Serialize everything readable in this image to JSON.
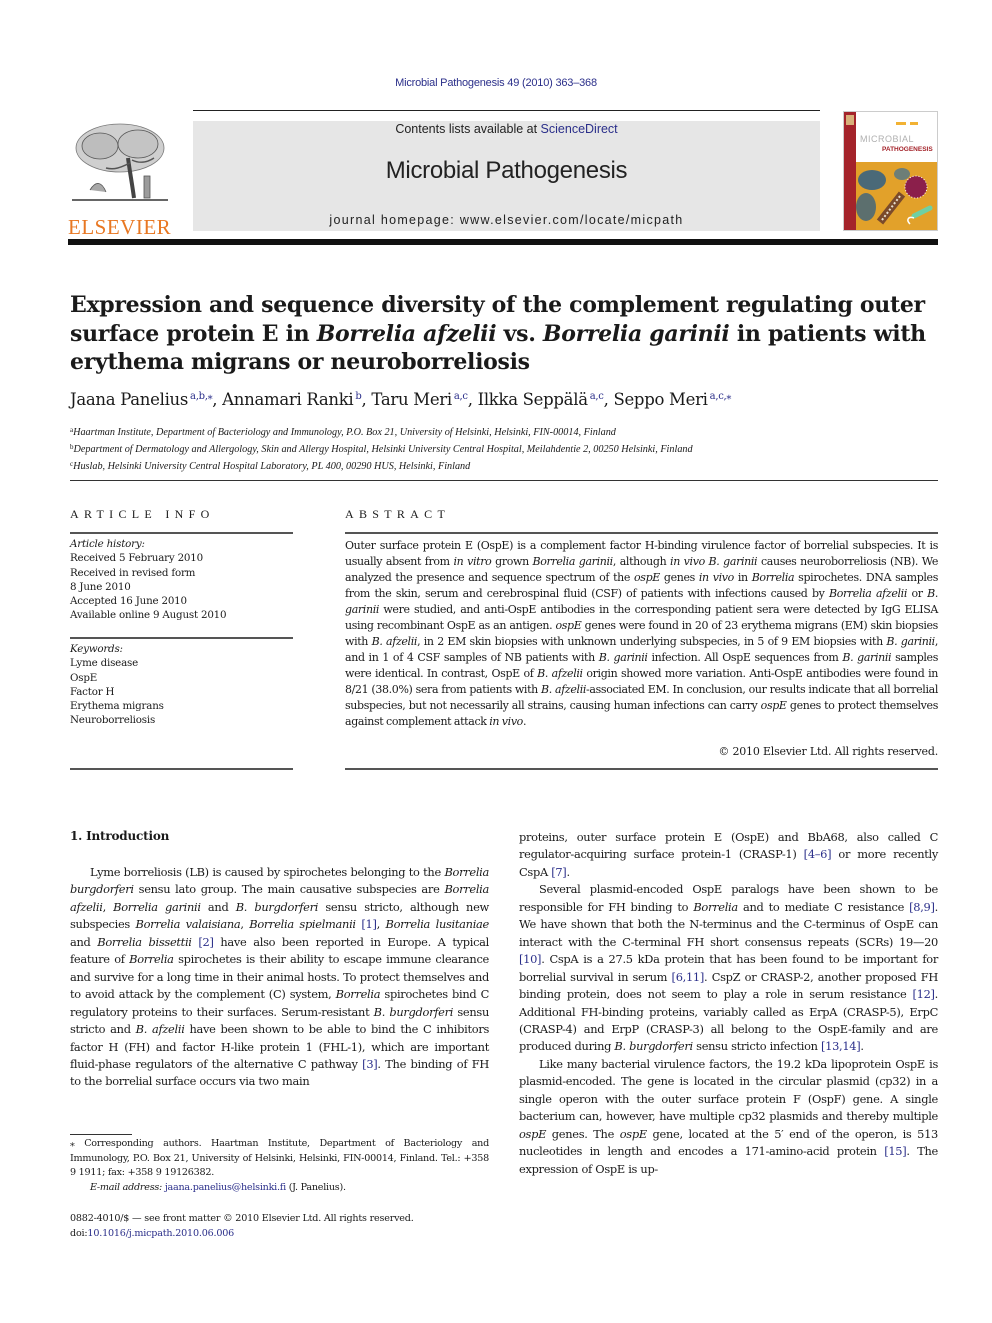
{
  "header": {
    "citation": "Microbial Pathogenesis 49 (2010) 363–368",
    "contents_prefix": "Contents lists available at ",
    "contents_link": "ScienceDirect",
    "journal_name": "Microbial Pathogenesis",
    "homepage_prefix": "journal homepage: ",
    "homepage_url": "www.elsevier.com/locate/micpath",
    "publisher_logo_text": "ELSEVIER",
    "cover": {
      "title_line1": "MICROBIAL",
      "title_line2": "PATHOGENESIS",
      "colors": {
        "spine": "#a4232a",
        "background": "#e2a12a",
        "cell": "#2f5f86",
        "particle": "#8b1f4b"
      }
    }
  },
  "colors": {
    "link": "#2b2f8a",
    "elsevier_orange": "#e87722",
    "banner_gray": "#e6e6e6"
  },
  "article": {
    "title_parts": [
      {
        "text": "Expression and sequence diversity of the complement regulating outer surface protein E in ",
        "italic": false
      },
      {
        "text": "Borrelia afzelii",
        "italic": true
      },
      {
        "text": " vs. ",
        "italic": false
      },
      {
        "text": "Borrelia garinii",
        "italic": true
      },
      {
        "text": " in patients with erythema migrans or neuroborreliosis",
        "italic": false
      }
    ],
    "authors": [
      {
        "name": "Jaana Panelius",
        "sup": "a,b,⁎"
      },
      {
        "name": "Annamari Ranki",
        "sup": "b"
      },
      {
        "name": "Taru Meri",
        "sup": "a,c"
      },
      {
        "name": "Ilkka Seppälä",
        "sup": "a,c"
      },
      {
        "name": "Seppo Meri",
        "sup": "a,c,⁎"
      }
    ],
    "affiliations": [
      {
        "key": "a",
        "text": "Haartman Institute, Department of Bacteriology and Immunology, P.O. Box 21, University of Helsinki, Helsinki, FIN-00014, Finland"
      },
      {
        "key": "b",
        "text": "Department of Dermatology and Allergology, Skin and Allergy Hospital, Helsinki University Central Hospital, Meilahdentie 2, 00250 Helsinki, Finland"
      },
      {
        "key": "c",
        "text": "Huslab, Helsinki University Central Hospital Laboratory, PL 400, 00290 HUS, Helsinki, Finland"
      }
    ]
  },
  "article_info": {
    "heading": "ARTICLE INFO",
    "history_label": "Article history:",
    "history": [
      "Received 5 February 2010",
      "Received in revised form",
      "8 June 2010",
      "Accepted 16 June 2010",
      "Available online 9 August 2010"
    ],
    "keywords_label": "Keywords:",
    "keywords": [
      "Lyme disease",
      "OspE",
      "Factor H",
      "Erythema migrans",
      "Neuroborreliosis"
    ]
  },
  "abstract": {
    "heading": "ABSTRACT",
    "parts": [
      {
        "t": "Outer surface protein E (OspE) is a complement factor H-binding virulence factor of borrelial subspecies. It is usually absent from "
      },
      {
        "t": "in vitro",
        "i": true
      },
      {
        "t": " grown "
      },
      {
        "t": "Borrelia garinii",
        "i": true
      },
      {
        "t": ", although "
      },
      {
        "t": "in vivo B. garinii",
        "i": true
      },
      {
        "t": " causes neuroborreliosis (NB). We analyzed the presence and sequence spectrum of the "
      },
      {
        "t": "ospE",
        "i": true
      },
      {
        "t": " genes "
      },
      {
        "t": "in vivo",
        "i": true
      },
      {
        "t": " in "
      },
      {
        "t": "Borrelia",
        "i": true
      },
      {
        "t": " spirochetes. DNA samples from the skin, serum and cerebrospinal fluid (CSF) of patients with infections caused by "
      },
      {
        "t": "Borrelia afzelii",
        "i": true
      },
      {
        "t": " or "
      },
      {
        "t": "B. garinii",
        "i": true
      },
      {
        "t": " were studied, and anti-OspE antibodies in the corresponding patient sera were detected by IgG ELISA using recombinant OspE as an antigen. "
      },
      {
        "t": "ospE",
        "i": true
      },
      {
        "t": " genes were found in 20 of 23 erythema migrans (EM) skin biopsies with "
      },
      {
        "t": "B. afzelii",
        "i": true
      },
      {
        "t": ", in 2 EM skin biopsies with unknown underlying subspecies, in 5 of 9 EM biopsies with "
      },
      {
        "t": "B. garinii",
        "i": true
      },
      {
        "t": ", and in 1 of 4 CSF samples of NB patients with "
      },
      {
        "t": "B. garinii",
        "i": true
      },
      {
        "t": " infection. All OspE sequences from "
      },
      {
        "t": "B. garinii",
        "i": true
      },
      {
        "t": " samples were identical. In contrast, OspE of "
      },
      {
        "t": "B. afzelii",
        "i": true
      },
      {
        "t": " origin showed more variation. Anti-OspE antibodies were found in 8/21 (38.0%) sera from patients with "
      },
      {
        "t": "B. afzelii",
        "i": true
      },
      {
        "t": "-associated EM. In conclusion, our results indicate that all borrelial subspecies, but not necessarily all strains, causing human infections can carry "
      },
      {
        "t": "ospE",
        "i": true
      },
      {
        "t": " genes to protect themselves against complement attack "
      },
      {
        "t": "in vivo",
        "i": true
      },
      {
        "t": "."
      }
    ],
    "copyright": "© 2010 Elsevier Ltd. All rights reserved."
  },
  "body": {
    "section_heading": "1.  Introduction",
    "left_paragraphs": [
      [
        {
          "t": "Lyme borreliosis (LB) is caused by spirochetes belonging to the "
        },
        {
          "t": "Borrelia burgdorferi",
          "i": true
        },
        {
          "t": " sensu lato group. The main causative subspecies are "
        },
        {
          "t": "Borrelia afzelii",
          "i": true
        },
        {
          "t": ", "
        },
        {
          "t": "Borrelia garinii",
          "i": true
        },
        {
          "t": " and "
        },
        {
          "t": "B. burgdorferi",
          "i": true
        },
        {
          "t": " sensu stricto, although new subspecies "
        },
        {
          "t": "Borrelia valaisiana",
          "i": true
        },
        {
          "t": ", "
        },
        {
          "t": "Borrelia spielmanii",
          "i": true
        },
        {
          "t": " "
        },
        {
          "t": "[1]",
          "r": true
        },
        {
          "t": ", "
        },
        {
          "t": "Borrelia lusitaniae",
          "i": true
        },
        {
          "t": " and "
        },
        {
          "t": "Borrelia bissettii",
          "i": true
        },
        {
          "t": " "
        },
        {
          "t": "[2]",
          "r": true
        },
        {
          "t": " have also been reported in Europe. A typical feature of "
        },
        {
          "t": "Borrelia",
          "i": true
        },
        {
          "t": " spirochetes is their ability to escape immune clearance and survive for a long time in their animal hosts. To protect themselves and to avoid attack by the complement (C) system, "
        },
        {
          "t": "Borrelia",
          "i": true
        },
        {
          "t": " spirochetes bind C regulatory proteins to their surfaces. Serum-resistant "
        },
        {
          "t": "B. burgdorferi",
          "i": true
        },
        {
          "t": " sensu stricto and "
        },
        {
          "t": "B. afzelii",
          "i": true
        },
        {
          "t": " have been shown to be able to bind the C inhibitors factor H (FH) and factor H-like protein 1 (FHL-1), which are important fluid-phase regulators of the alternative C pathway "
        },
        {
          "t": "[3]",
          "r": true
        },
        {
          "t": ". The binding of FH to the borrelial surface occurs via two main"
        }
      ]
    ],
    "right_paragraphs": [
      [
        {
          "t": "proteins, outer surface protein E (OspE) and BbA68, also called C regulator-acquiring surface protein-1 (CRASP-1) "
        },
        {
          "t": "[4–6]",
          "r": true
        },
        {
          "t": " or more recently CspA "
        },
        {
          "t": "[7]",
          "r": true
        },
        {
          "t": "."
        }
      ],
      [
        {
          "t": "Several plasmid-encoded OspE paralogs have been shown to be responsible for FH binding to "
        },
        {
          "t": "Borrelia",
          "i": true
        },
        {
          "t": " and to mediate C resistance "
        },
        {
          "t": "[8,9]",
          "r": true
        },
        {
          "t": ". We have shown that both the N-terminus and the C-terminus of OspE can interact with the C-terminal FH short consensus repeats (SCRs) 19—20 "
        },
        {
          "t": "[10]",
          "r": true
        },
        {
          "t": ". CspA is a 27.5 kDa protein that has been found to be important for borrelial survival in serum "
        },
        {
          "t": "[6,11]",
          "r": true
        },
        {
          "t": ". CspZ or CRASP-2, another proposed FH binding protein, does not seem to play a role in serum resistance "
        },
        {
          "t": "[12]",
          "r": true
        },
        {
          "t": ". Additional FH-binding proteins, variably called as ErpA (CRASP-5), ErpC (CRASP-4) and ErpP (CRASP-3) all belong to the OspE-family and are produced during "
        },
        {
          "t": "B. burgdorferi",
          "i": true
        },
        {
          "t": " sensu stricto infection "
        },
        {
          "t": "[13,14]",
          "r": true
        },
        {
          "t": "."
        }
      ],
      [
        {
          "t": "Like many bacterial virulence factors, the 19.2 kDa lipoprotein OspE is plasmid-encoded. The gene is located in the circular plasmid (cp32) in a single operon with the outer surface protein F (OspF) gene. A single bacterium can, however, have multiple cp32 plasmids and thereby multiple "
        },
        {
          "t": "ospE",
          "i": true
        },
        {
          "t": " genes. The "
        },
        {
          "t": "ospE",
          "i": true
        },
        {
          "t": " gene, located at the 5′ end of the operon, is 513 nucleotides in length and encodes a 171-amino-acid protein "
        },
        {
          "t": "[15]",
          "r": true
        },
        {
          "t": ". The expression of OspE is up-"
        }
      ]
    ]
  },
  "footnotes": {
    "corresponding": "⁎ Corresponding authors. Haartman Institute, Department of Bacteriology and Immunology, P.O. Box 21, University of Helsinki, Helsinki, FIN-00014, Finland. Tel.: +358 9 1911; fax: +358 9 19126382.",
    "email_label": "E-mail address: ",
    "email": "jaana.panelius@helsinki.fi",
    "email_suffix": " (J. Panelius).",
    "issn_line": "0882-4010/$ — see front matter © 2010 Elsevier Ltd. All rights reserved.",
    "doi_label": "doi:",
    "doi": "10.1016/j.micpath.2010.06.006"
  }
}
